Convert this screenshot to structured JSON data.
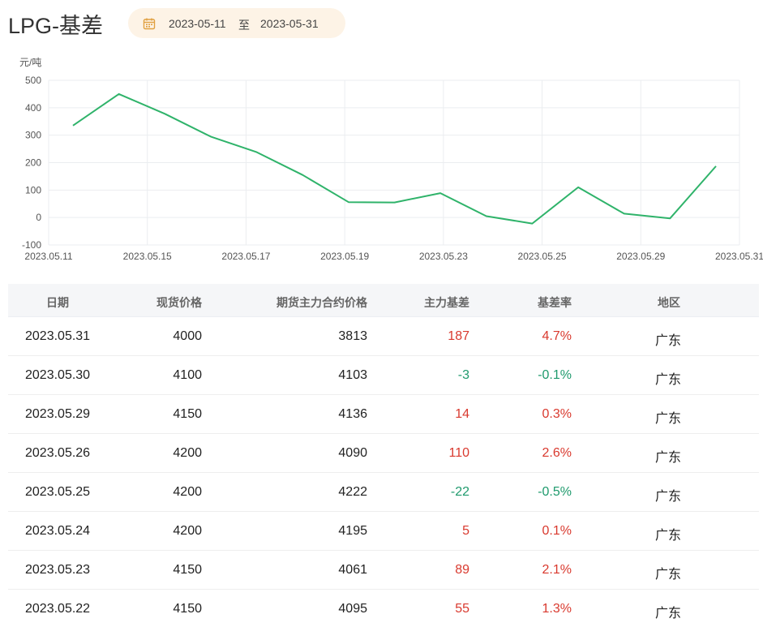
{
  "header": {
    "title": "LPG-基差",
    "date_from": "2023-05-11",
    "date_sep": "至",
    "date_to": "2023-05-31"
  },
  "chart_data": {
    "type": "line",
    "ylabel": "元/吨",
    "ylim": [
      -100,
      500
    ],
    "yticks": [
      "500",
      "400",
      "300",
      "200",
      "100",
      "0",
      "-100"
    ],
    "xticks": [
      "2023.05.11",
      "2023.05.15",
      "2023.05.17",
      "2023.05.19",
      "2023.05.23",
      "2023.05.25",
      "2023.05.29",
      "2023.05.31"
    ],
    "grid": true,
    "line_color": "#2fb36a",
    "series": [
      {
        "x": [
          "2023.05.11",
          "2023.05.12",
          "2023.05.15",
          "2023.05.16",
          "2023.05.17",
          "2023.05.18",
          "2023.05.19",
          "2023.05.22",
          "2023.05.23",
          "2023.05.24",
          "2023.05.25",
          "2023.05.26",
          "2023.05.29",
          "2023.05.30",
          "2023.05.31"
        ],
        "values": [
          335,
          450,
          378,
          295,
          238,
          155,
          56,
          55,
          89,
          5,
          -22,
          110,
          14,
          -3,
          187
        ]
      }
    ]
  },
  "table": {
    "headers": {
      "date": "日期",
      "spot": "现货价格",
      "futures": "期货主力合约价格",
      "basis": "主力基差",
      "rate": "基差率",
      "region": "地区"
    },
    "rows": [
      {
        "date": "2023.05.31",
        "spot": "4000",
        "futures": "3813",
        "basis": "187",
        "rate": "4.7%",
        "region": "广东",
        "sign": "pos"
      },
      {
        "date": "2023.05.30",
        "spot": "4100",
        "futures": "4103",
        "basis": "-3",
        "rate": "-0.1%",
        "region": "广东",
        "sign": "neg"
      },
      {
        "date": "2023.05.29",
        "spot": "4150",
        "futures": "4136",
        "basis": "14",
        "rate": "0.3%",
        "region": "广东",
        "sign": "pos"
      },
      {
        "date": "2023.05.26",
        "spot": "4200",
        "futures": "4090",
        "basis": "110",
        "rate": "2.6%",
        "region": "广东",
        "sign": "pos"
      },
      {
        "date": "2023.05.25",
        "spot": "4200",
        "futures": "4222",
        "basis": "-22",
        "rate": "-0.5%",
        "region": "广东",
        "sign": "neg"
      },
      {
        "date": "2023.05.24",
        "spot": "4200",
        "futures": "4195",
        "basis": "5",
        "rate": "0.1%",
        "region": "广东",
        "sign": "pos"
      },
      {
        "date": "2023.05.23",
        "spot": "4150",
        "futures": "4061",
        "basis": "89",
        "rate": "2.1%",
        "region": "广东",
        "sign": "pos"
      },
      {
        "date": "2023.05.22",
        "spot": "4150",
        "futures": "4095",
        "basis": "55",
        "rate": "1.3%",
        "region": "广东",
        "sign": "pos"
      }
    ]
  }
}
